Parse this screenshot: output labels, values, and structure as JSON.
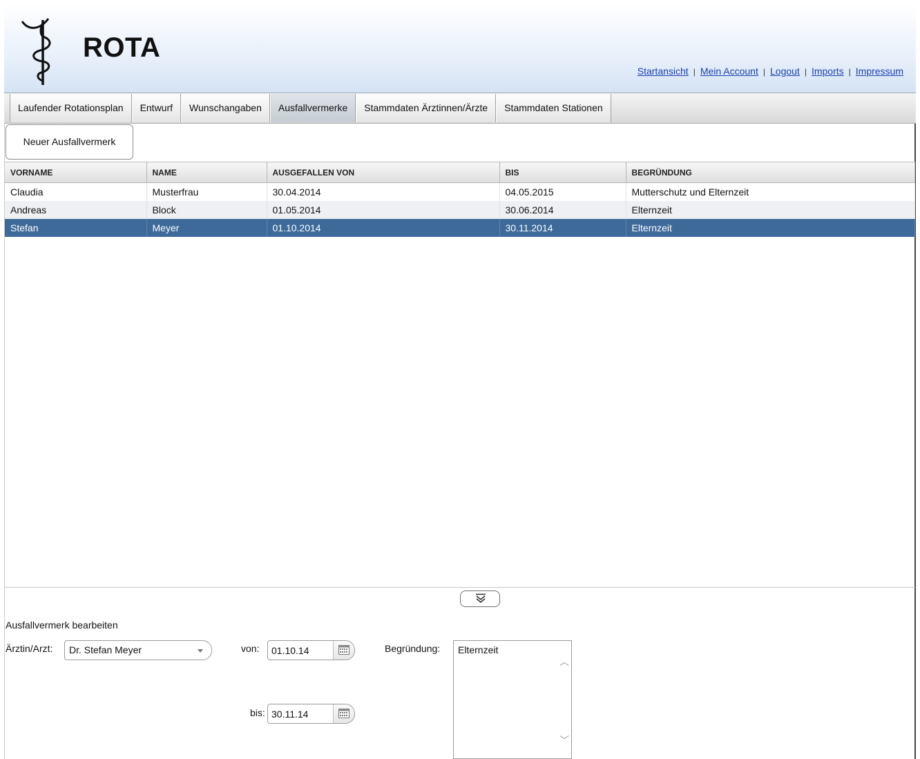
{
  "header": {
    "app_title": "ROTA",
    "links": [
      {
        "label": "Startansicht"
      },
      {
        "label": "Mein Account"
      },
      {
        "label": "Logout"
      },
      {
        "label": "Imports"
      },
      {
        "label": "Impressum"
      }
    ],
    "separator": "|"
  },
  "tabs": [
    {
      "label": "Laufender Rotationsplan",
      "active": false
    },
    {
      "label": "Entwurf",
      "active": false
    },
    {
      "label": "Wunschangaben",
      "active": false
    },
    {
      "label": "Ausfallvermerke",
      "active": true
    },
    {
      "label": "Stammdaten Ärztinnen/Ärzte",
      "active": false
    },
    {
      "label": "Stammdaten Stationen",
      "active": false
    }
  ],
  "toolbar": {
    "new_label": "Neuer Ausfallvermerk"
  },
  "table": {
    "columns": [
      "VORNAME",
      "NAME",
      "AUSGEFALLEN VON",
      "BIS",
      "BEGRÜNDUNG"
    ],
    "rows": [
      {
        "vorname": "Claudia",
        "name": "Musterfrau",
        "von": "30.04.2014",
        "bis": "04.05.2015",
        "begruendung": "Mutterschutz und Elternzeit",
        "selected": false
      },
      {
        "vorname": "Andreas",
        "name": "Block",
        "von": "01.05.2014",
        "bis": "30.06.2014",
        "begruendung": "Elternzeit",
        "selected": false
      },
      {
        "vorname": "Stefan",
        "name": "Meyer",
        "von": "01.10.2014",
        "bis": "30.11.2014",
        "begruendung": "Elternzeit",
        "selected": true
      }
    ]
  },
  "edit": {
    "title": "Ausfallvermerk bearbeiten",
    "doctor_label": "Ärztin/Arzt:",
    "doctor_value": "Dr. Stefan Meyer",
    "von_label": "von:",
    "von_value": "01.10.14",
    "bis_label": "bis:",
    "bis_value": "30.11.14",
    "reason_label": "Begründung:",
    "reason_value": "Elternzeit"
  },
  "colors": {
    "selected_row": "#3e6a9a",
    "link": "#1a3fb0",
    "header_gradient_end": "#d4e3f5"
  }
}
